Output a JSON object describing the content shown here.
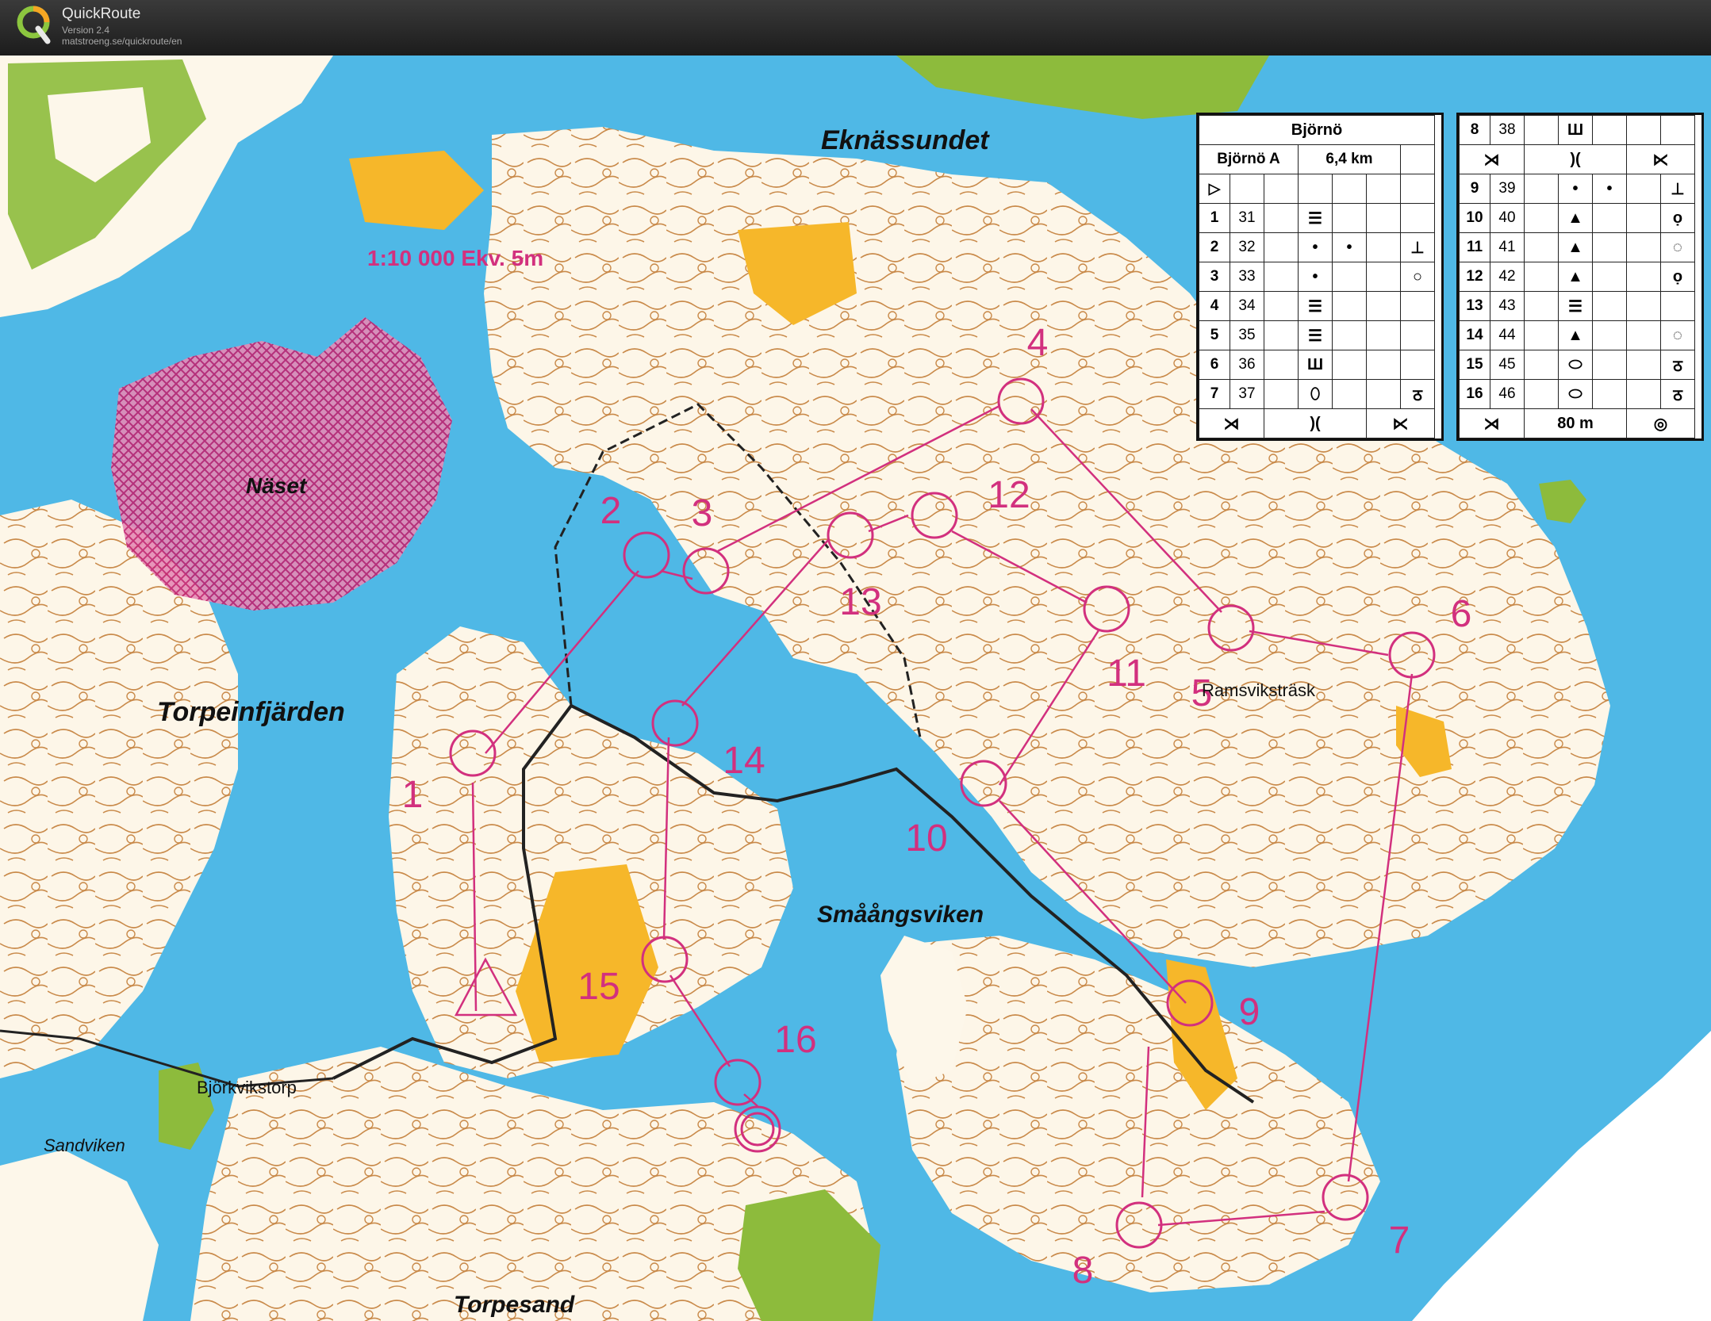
{
  "app": {
    "title": "QuickRoute",
    "version": "Version 2.4",
    "url": "matstroeng.se/quickroute/en",
    "logo_letter": "Q"
  },
  "map": {
    "scale_text": "1:10 000 Ekv. 5m",
    "place_names": {
      "eknassundet": "Eknässundet",
      "naset": "Näset",
      "torpeinfjarden": "Torpeinfjärden",
      "ramsvikstrask": "Ramsviksträsk",
      "smaangsviken": "Småångsviken",
      "bjorkvikstorp": "Björkvikstorp",
      "sandviken": "Sandviken",
      "torpesand": "Torpesand"
    },
    "colors": {
      "water": "#4fb8e6",
      "land": "#fdf7ea",
      "open": "#f6b72a",
      "green": "#8dbb3c",
      "contour": "#b8732e",
      "course": "#d2307e",
      "forbidden": "#d2307e"
    },
    "controls": [
      {
        "label": "1"
      },
      {
        "label": "2"
      },
      {
        "label": "3"
      },
      {
        "label": "4"
      },
      {
        "label": "5"
      },
      {
        "label": "6"
      },
      {
        "label": "7"
      },
      {
        "label": "8"
      },
      {
        "label": "9"
      },
      {
        "label": "11"
      },
      {
        "label": "12"
      },
      {
        "label": "13"
      },
      {
        "label": "14"
      },
      {
        "label": "15"
      },
      {
        "label": "16"
      },
      {
        "label": "10"
      }
    ]
  },
  "description_sheet": {
    "event": "Björnö",
    "course": "Björnö A",
    "length": "6,4 km",
    "finish_distance": "80 m",
    "rows_left": [
      {
        "num": "1",
        "code": "31"
      },
      {
        "num": "2",
        "code": "32"
      },
      {
        "num": "3",
        "code": "33"
      },
      {
        "num": "4",
        "code": "34"
      },
      {
        "num": "5",
        "code": "35"
      },
      {
        "num": "6",
        "code": "36"
      },
      {
        "num": "7",
        "code": "37"
      }
    ],
    "rows_right": [
      {
        "num": "8",
        "code": "38"
      },
      {
        "num": "9",
        "code": "39"
      },
      {
        "num": "10",
        "code": "40"
      },
      {
        "num": "11",
        "code": "41"
      },
      {
        "num": "12",
        "code": "42"
      },
      {
        "num": "13",
        "code": "43"
      },
      {
        "num": "14",
        "code": "44"
      },
      {
        "num": "15",
        "code": "45"
      },
      {
        "num": "16",
        "code": "46"
      }
    ]
  }
}
